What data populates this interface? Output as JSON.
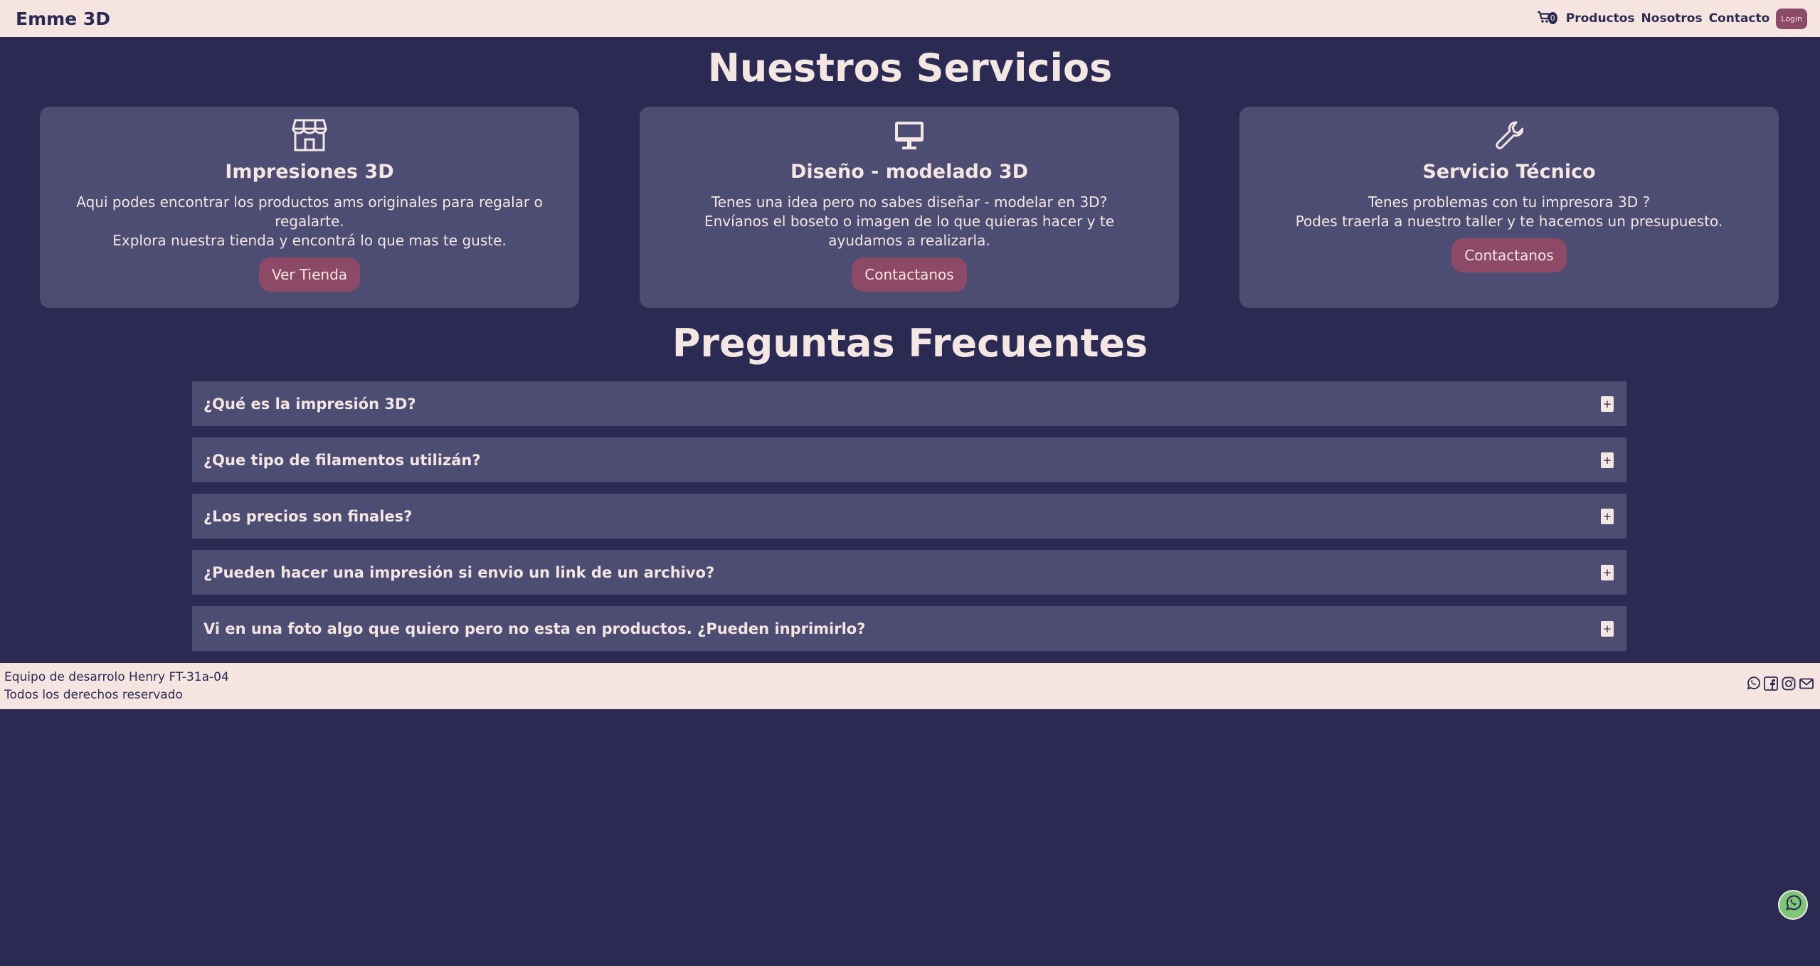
{
  "header": {
    "brand": "Emme 3D",
    "cart_count": "0",
    "nav": [
      "Productos",
      "Nosotros",
      "Contacto"
    ],
    "login_label": "Login"
  },
  "services": {
    "title": "Nuestros Servicios",
    "cards": [
      {
        "icon": "store-icon",
        "title": "Impresiones 3D",
        "lines": [
          "Aqui podes encontrar los productos ams originales para regalar o regalarte.",
          "Explora nuestra tienda y encontrá lo que mas te guste."
        ],
        "button": "Ver Tienda"
      },
      {
        "icon": "monitor-icon",
        "title": "Diseño - modelado 3D",
        "lines": [
          "Tenes una idea pero no sabes diseñar - modelar en 3D?",
          "Envíanos el boseto o imagen de lo que quieras hacer y te ayudamos a realizarla."
        ],
        "button": "Contactanos"
      },
      {
        "icon": "wrench-icon",
        "title": "Servicio Técnico",
        "lines": [
          "Tenes problemas con tu impresora 3D ?",
          "Podes traerla a nuestro taller y te hacemos un presupuesto."
        ],
        "button": "Contactanos"
      }
    ]
  },
  "faq": {
    "title": "Preguntas Frecuentes",
    "toggle_symbol": "+",
    "items": [
      "¿Qué es la impresión 3D?",
      "¿Que tipo de filamentos utilizán?",
      "¿Los precios son finales?",
      "¿Pueden hacer una impresión si envio un link de un archivo?",
      "Vi en una foto algo que quiero pero no esta en productos. ¿Pueden inprimirlo?"
    ]
  },
  "footer": {
    "line1": "Equipo de desarrolo Henry FT-31a-04",
    "line2": "Todos los derechos reservado",
    "social_icons": [
      "whatsapp-icon",
      "facebook-icon",
      "instagram-icon",
      "mail-icon"
    ]
  },
  "colors": {
    "background": "#2a2a52",
    "header_bg": "#f6e4e1",
    "card_bg": "#4d4c72",
    "accent": "#8c4a67",
    "whatsapp": "#7fc778"
  }
}
